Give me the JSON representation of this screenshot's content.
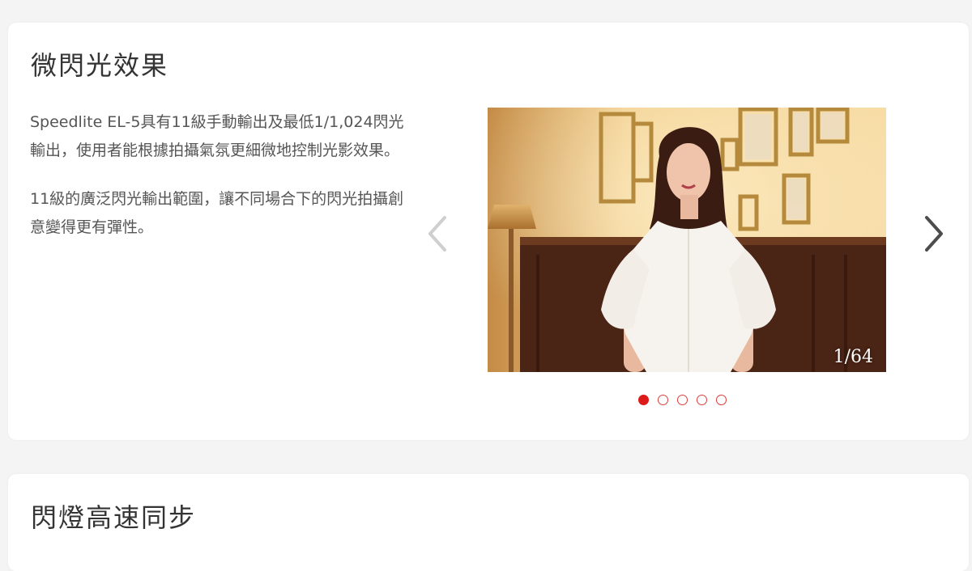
{
  "colors": {
    "accent": "#dd1b1b",
    "page_bg": "#f4f4f4",
    "card_bg": "#ffffff",
    "text": "#555555",
    "title": "#333333"
  },
  "section1": {
    "title": "微閃光效果",
    "paragraphs": [
      "Speedlite EL-5具有11級手動輸出及最低1/1,024閃光輸出，使用者能根據拍攝氣氛更細微地控制光影效果。",
      "11級的廣泛閃光輸出範圍，讓不同場合下的閃光拍攝創意變得更有彈性。"
    ],
    "carousel": {
      "counter": "1/64",
      "slide_count": 5,
      "active_index": 0,
      "prev_icon": "chevron-left-icon",
      "next_icon": "chevron-right-icon"
    }
  },
  "section2": {
    "title": "閃燈高速同步"
  }
}
